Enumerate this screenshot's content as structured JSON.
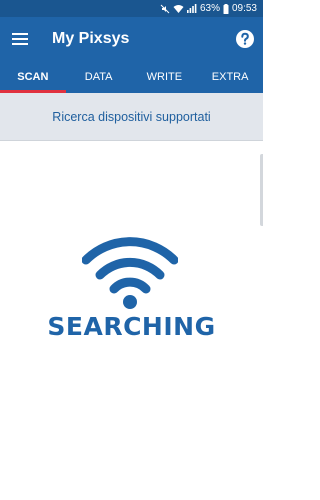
{
  "status_bar": {
    "battery": "63%",
    "time": "09:53",
    "icons": [
      "mute-icon",
      "wifi-signal-icon",
      "cell-signal-icon",
      "battery-icon"
    ]
  },
  "app_bar": {
    "title": "My Pixsys",
    "menu_icon": "hamburger-menu-icon",
    "help_icon": "help-icon"
  },
  "tabs": [
    {
      "label": "SCAN",
      "active": true
    },
    {
      "label": "DATA",
      "active": false
    },
    {
      "label": "WRITE",
      "active": false
    },
    {
      "label": "EXTRA",
      "active": false
    }
  ],
  "subheader": {
    "text": "Ricerca dispositivi supportati"
  },
  "main": {
    "status_label": "SEARCHING",
    "status_icon": "wifi-searching-icon"
  },
  "colors": {
    "status_bar": "#1a5690",
    "app_bar": "#1f64a8",
    "tab_indicator": "#e0313f",
    "subheader_bg": "#e2e6ec",
    "subheader_text": "#1f5f9e",
    "accent": "#1f64a8"
  }
}
